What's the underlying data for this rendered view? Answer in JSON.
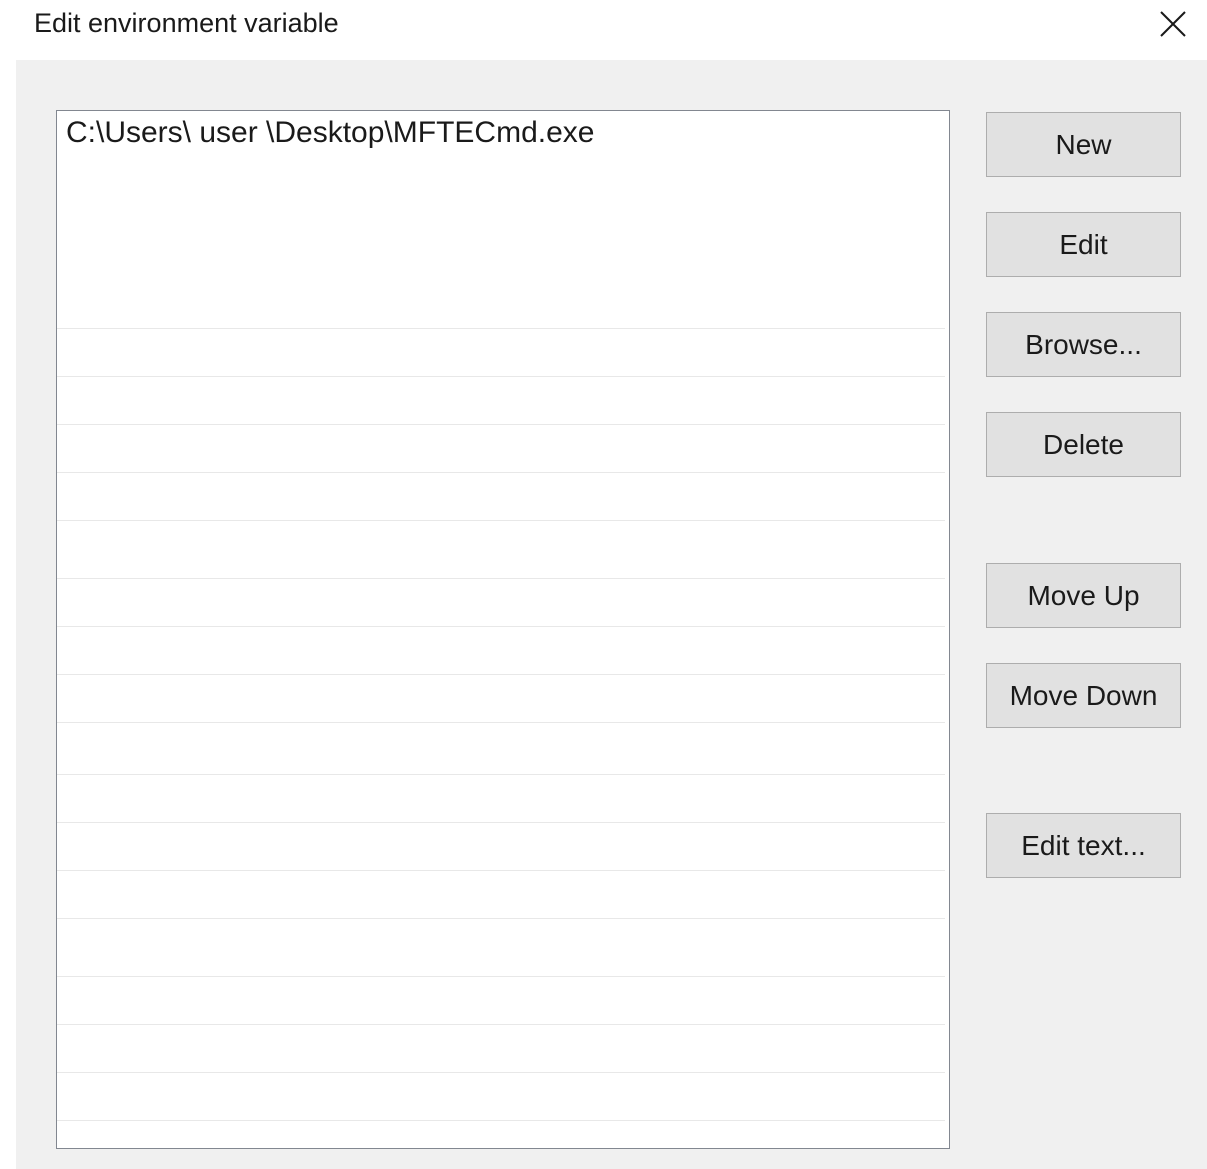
{
  "window": {
    "title": "Edit environment variable",
    "close_icon": "close-icon"
  },
  "list": {
    "items": [
      {
        "value": "C:\\Users\\ user \\Desktop\\MFTECmd.exe"
      }
    ]
  },
  "buttons": {
    "new": "New",
    "edit": "Edit",
    "browse": "Browse...",
    "delete": "Delete",
    "move_up": "Move Up",
    "move_down": "Move Down",
    "edit_text": "Edit text..."
  },
  "colors": {
    "client_background": "#f0f0f0",
    "button_face": "#e1e1e1",
    "button_border": "#adadad",
    "list_border": "#828790"
  }
}
